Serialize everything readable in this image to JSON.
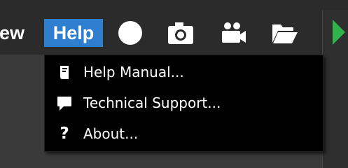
{
  "menubar": {
    "view_label": "View",
    "help_label": "Help",
    "help_bg": "#2f7fd1"
  },
  "toolbar": {
    "icons": [
      "record-circle-icon",
      "camera-icon",
      "video-camera-icon",
      "folder-open-icon",
      "play-icon"
    ],
    "play_color": "#2fb34a"
  },
  "help_menu": {
    "items": [
      {
        "label": "Help Manual...",
        "icon": "book-icon"
      },
      {
        "label": "Technical Support...",
        "icon": "chat-bubble-icon"
      },
      {
        "label": "About...",
        "icon": "question-mark-icon",
        "glyph": "?"
      }
    ]
  }
}
